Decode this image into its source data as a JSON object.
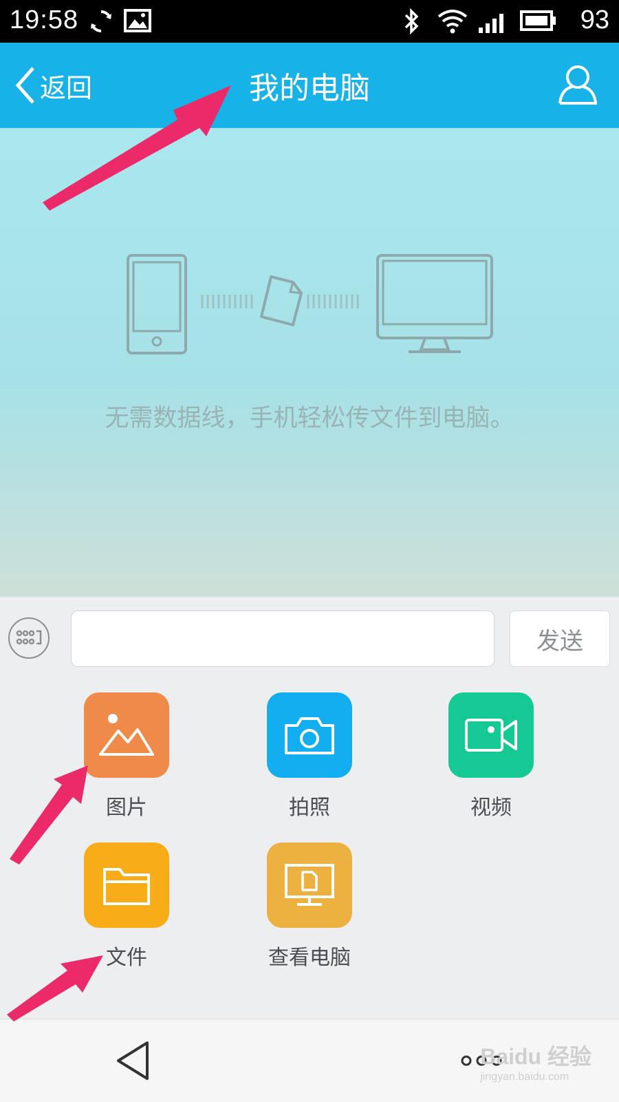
{
  "status_bar": {
    "time": "19:58",
    "battery_level": "93",
    "icons": [
      "sync-icon",
      "gallery-icon",
      "bluetooth-icon",
      "wifi-icon",
      "signal-icon",
      "battery-icon"
    ]
  },
  "header": {
    "back_label": "返回",
    "title": "我的电脑",
    "profile_icon": "person-icon",
    "background": "#17b2e8"
  },
  "hero": {
    "message": "无需数据线，手机轻松传文件到电脑。",
    "illustration_icons": [
      "phone-icon",
      "file-icon",
      "monitor-icon"
    ]
  },
  "composer": {
    "keyboard_icon": "keyboard-icon",
    "input_value": "",
    "send_label": "发送"
  },
  "tools": [
    {
      "label": "图片",
      "icon": "image-icon",
      "color": "#f08a48"
    },
    {
      "label": "拍照",
      "icon": "camera-icon",
      "color": "#12aef0"
    },
    {
      "label": "视频",
      "icon": "video-icon",
      "color": "#15c994"
    },
    {
      "label": "文件",
      "icon": "folder-icon",
      "color": "#f7ac18"
    },
    {
      "label": "查看电脑",
      "icon": "view-computer-icon",
      "color": "#ecb13f"
    }
  ],
  "nav_bar": {
    "icons": [
      "back-triangle-icon",
      "menu-dots-icon"
    ]
  },
  "annotations": {
    "arrow_color": "#ec2a6a",
    "watermark_text": "Baidu 经验",
    "watermark_url": "jingyan.baidu.com"
  }
}
